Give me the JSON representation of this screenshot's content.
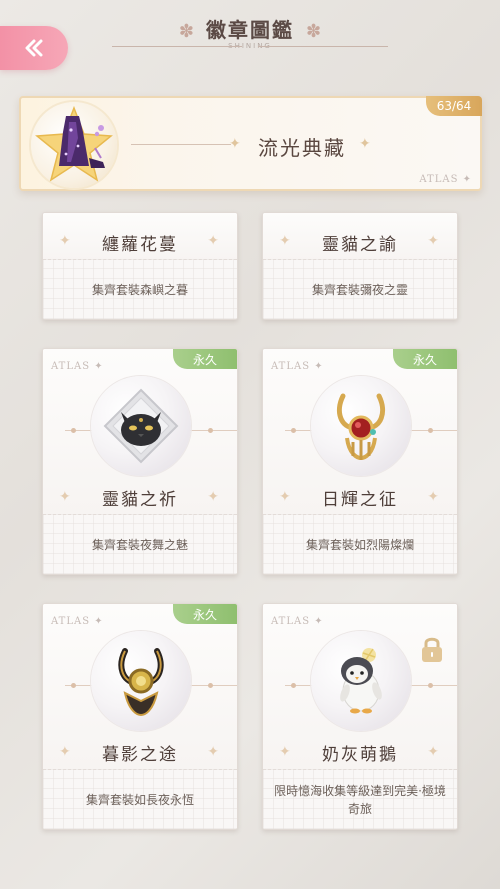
{
  "header": {
    "title": "徽章圖鑑",
    "subtitle": "SHINING",
    "back_icon": "double-chevron-left-icon"
  },
  "featured": {
    "name": "流光典藏",
    "count": "63/64",
    "atlas": "ATLAS ✦"
  },
  "cards": [
    {
      "name": "纏蘿花蔓",
      "desc": "集齊套裝森嶼之暮",
      "badge": "",
      "atlas": ""
    },
    {
      "name": "靈貓之諭",
      "desc": "集齊套裝彌夜之靈",
      "badge": "",
      "atlas": ""
    },
    {
      "name": "靈貓之祈",
      "desc": "集齊套裝夜舞之魅",
      "badge": "永久",
      "atlas": "ATLAS ✦"
    },
    {
      "name": "日輝之征",
      "desc": "集齊套裝如烈陽燦爛",
      "badge": "永久",
      "atlas": "ATLAS ✦"
    },
    {
      "name": "暮影之途",
      "desc": "集齊套裝如長夜永恆",
      "badge": "永久",
      "atlas": "ATLAS ✦"
    },
    {
      "name": "奶灰萌鵝",
      "desc": "限時憶海收集等級達到完美·極境奇旅",
      "badge": "",
      "atlas": "ATLAS ✦",
      "locked": true
    }
  ],
  "colors": {
    "back_button": "#f391a6",
    "permanent_badge": "#9cc77e",
    "count_badge": "#dfb46b"
  }
}
